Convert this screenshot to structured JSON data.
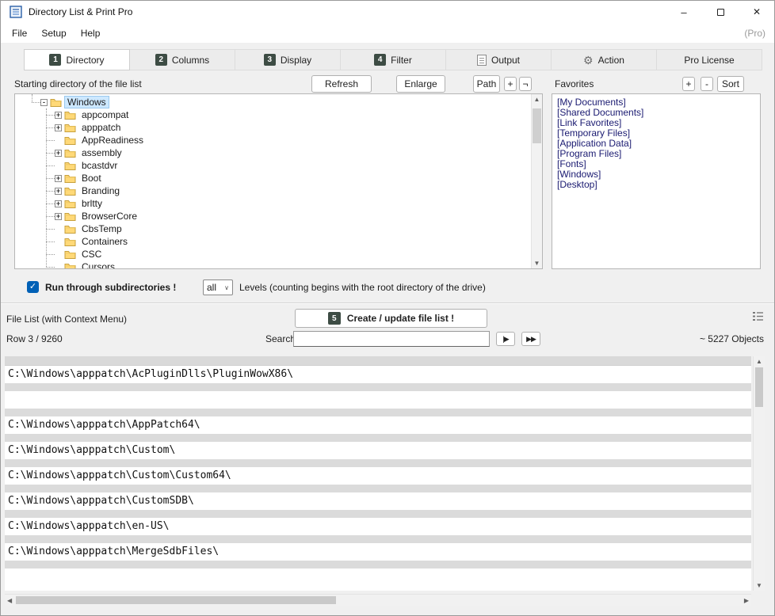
{
  "window": {
    "title": "Directory List & Print Pro",
    "pro_badge": "(Pro)",
    "minimize": "–",
    "close": "✕"
  },
  "menu": {
    "items": [
      {
        "label": "File"
      },
      {
        "label": "Setup"
      },
      {
        "label": "Help"
      }
    ]
  },
  "tabs": [
    {
      "badge": "1",
      "label": "Directory",
      "active": true
    },
    {
      "badge": "2",
      "label": "Columns",
      "active": false
    },
    {
      "badge": "3",
      "label": "Display",
      "active": false
    },
    {
      "badge": "4",
      "label": "Filter",
      "active": false
    },
    {
      "icon": "document-icon",
      "label": "Output",
      "active": false
    },
    {
      "icon": "gear-icon",
      "label": "Action",
      "active": false
    },
    {
      "label": "Pro License",
      "active": false
    }
  ],
  "directory_tab": {
    "starting_dir_label": "Starting directory of the file list",
    "buttons": {
      "refresh": "Refresh",
      "enlarge": "Enlarge",
      "path": "Path",
      "expand": "+",
      "negate": "¬"
    },
    "favorites": {
      "label": "Favorites",
      "add": "+",
      "remove": "-",
      "sort": "Sort",
      "items": [
        "[My Documents]",
        "[Shared Documents]",
        "[Link Favorites]",
        "[Temporary Files]",
        "[Application Data]",
        "[Program Files]",
        "[Fonts]",
        "[Windows]",
        "[Desktop]"
      ]
    },
    "tree": {
      "items": [
        {
          "label": "Windows",
          "level": 0,
          "exp": "-",
          "selected": true
        },
        {
          "label": "appcompat",
          "level": 1,
          "exp": "+"
        },
        {
          "label": "apppatch",
          "level": 1,
          "exp": "+"
        },
        {
          "label": "AppReadiness",
          "level": 1,
          "exp": ""
        },
        {
          "label": "assembly",
          "level": 1,
          "exp": "+"
        },
        {
          "label": "bcastdvr",
          "level": 1,
          "exp": ""
        },
        {
          "label": "Boot",
          "level": 1,
          "exp": "+"
        },
        {
          "label": "Branding",
          "level": 1,
          "exp": "+"
        },
        {
          "label": "brltty",
          "level": 1,
          "exp": "+"
        },
        {
          "label": "BrowserCore",
          "level": 1,
          "exp": "+"
        },
        {
          "label": "CbsTemp",
          "level": 1,
          "exp": ""
        },
        {
          "label": "Containers",
          "level": 1,
          "exp": ""
        },
        {
          "label": "CSC",
          "level": 1,
          "exp": ""
        },
        {
          "label": "Cursors",
          "level": 1,
          "exp": ""
        }
      ]
    },
    "subdirs": {
      "checked": true,
      "checkmark": "✓",
      "label": "Run through subdirectories !",
      "levels_value": "all",
      "levels_text": "Levels  (counting begins with the root directory of the drive)"
    }
  },
  "file_list": {
    "header_label": "File List (with Context Menu)",
    "create_badge": "5",
    "create_label": "Create / update file list !",
    "row_status": "Row 3 / 9260",
    "search_label": "Search",
    "search_value": "",
    "play_one": "|▶",
    "play_all": "▶▶",
    "object_count": "~ 5227 Objects",
    "rows": [
      "C:\\Windows\\apppatch\\AcPluginDlls\\PluginWowX86\\",
      "",
      "C:\\Windows\\apppatch\\AppPatch64\\",
      "C:\\Windows\\apppatch\\Custom\\",
      "C:\\Windows\\apppatch\\Custom\\Custom64\\",
      "C:\\Windows\\apppatch\\CustomSDB\\",
      "C:\\Windows\\apppatch\\en-US\\",
      "C:\\Windows\\apppatch\\MergeSdbFiles\\"
    ]
  }
}
